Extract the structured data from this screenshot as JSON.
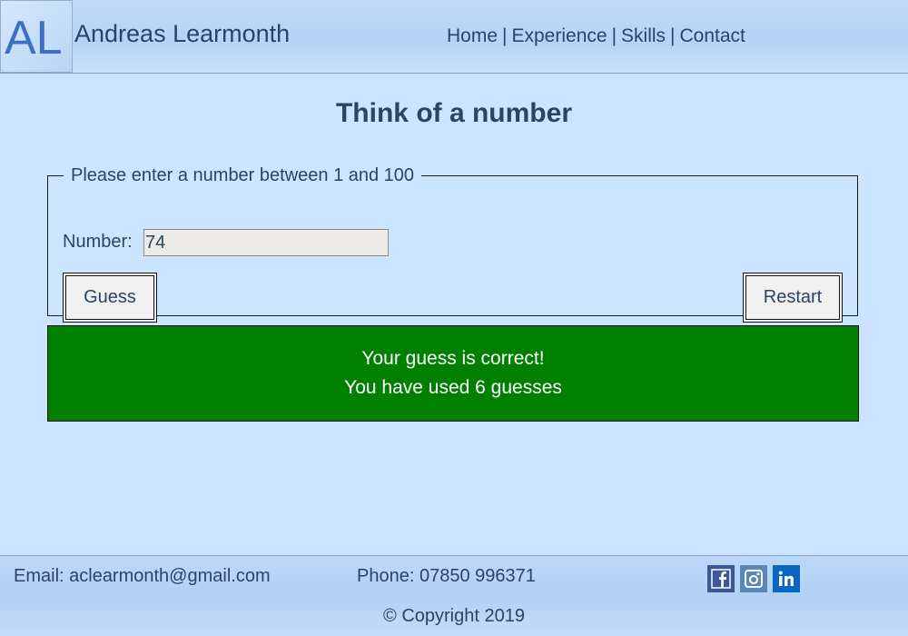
{
  "header": {
    "logo_text": "AL",
    "site_name": "Andreas Learmonth",
    "nav": [
      {
        "label": "Home"
      },
      {
        "label": "Experience"
      },
      {
        "label": "Skills"
      },
      {
        "label": "Contact"
      }
    ],
    "nav_separator": "|"
  },
  "main": {
    "title": "Think of a number",
    "form": {
      "legend": "Please enter a number between 1 and 100",
      "number_label": "Number:",
      "number_value": "74",
      "guess_label": "Guess",
      "restart_label": "Restart"
    },
    "result": {
      "line1": "Your guess is correct!",
      "line2": "You have used 6 guesses",
      "color": "#008000"
    }
  },
  "footer": {
    "email": "Email: aclearmonth@gmail.com",
    "phone": "Phone: 07850 996371",
    "copyright": "© Copyright 2019",
    "social": [
      "facebook-icon",
      "instagram-icon",
      "linkedin-icon"
    ]
  }
}
